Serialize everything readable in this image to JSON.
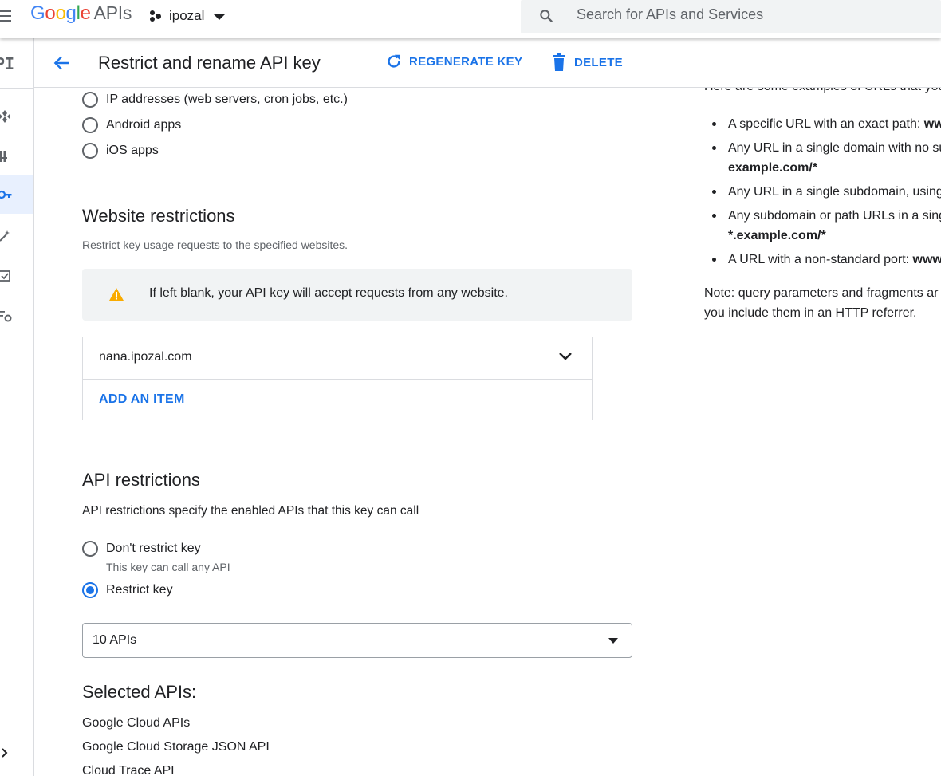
{
  "topbar": {
    "logo_letters": [
      "G",
      "o",
      "o",
      "g",
      "l",
      "e"
    ],
    "logo_suffix": "APIs",
    "project_name": "ipozal",
    "search_placeholder": "Search for APIs and Services"
  },
  "rail": {
    "label": "PI"
  },
  "header": {
    "title": "Restrict and rename API key",
    "regenerate_label": "REGENERATE KEY",
    "delete_label": "DELETE"
  },
  "app_restrictions": {
    "options": [
      "IP addresses (web servers, cron jobs, etc.)",
      "Android apps",
      "iOS apps"
    ]
  },
  "website_restrictions": {
    "title": "Website restrictions",
    "description": "Restrict key usage requests to the specified websites.",
    "warning": "If left blank, your API key will accept requests from any website.",
    "item_value": "nana.ipozal.com",
    "add_item_label": "ADD AN ITEM"
  },
  "api_restrictions": {
    "title": "API restrictions",
    "description": "API restrictions specify the enabled APIs that this key can call",
    "dont_restrict_label": "Don't restrict key",
    "dont_restrict_sub": "This key can call any API",
    "restrict_label": "Restrict key",
    "selected_value": "10 APIs",
    "selected_title": "Selected APIs:",
    "selected_list": [
      "Google Cloud APIs",
      "Google Cloud Storage JSON API",
      "Cloud Trace API"
    ]
  },
  "help_panel": {
    "intro_cut": "Here are some examples of URLs that you",
    "examples": [
      {
        "text": "A specific URL with an exact path: ",
        "bold": "ww"
      },
      {
        "text": "Any URL in a single domain with no su",
        "bold": ""
      },
      {
        "text": "",
        "bold": "example.com/*"
      },
      {
        "text": "Any URL in a single subdomain, using",
        "bold": ""
      },
      {
        "text": "Any subdomain or path URLs in a sing",
        "bold": ""
      },
      {
        "text": "",
        "bold": "*.example.com/*"
      },
      {
        "text": "A URL with a non-standard port: ",
        "bold": "www"
      }
    ],
    "note_line1": "Note: query parameters and fragments ar",
    "note_line2": "you include them in an HTTP referrer."
  },
  "colors": {
    "accent": "#1a73e8",
    "warning": "#f9ab00",
    "text": "#202124",
    "muted": "#5f6368"
  }
}
